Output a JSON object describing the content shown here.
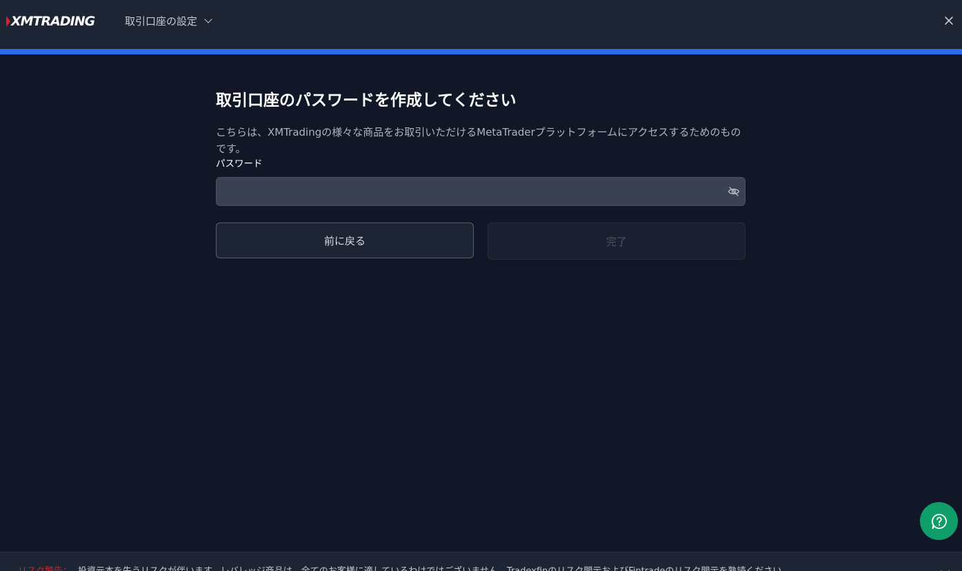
{
  "header": {
    "logo_text": "XMTRADING",
    "menu_title": "取引口座の設定"
  },
  "progress": {
    "fraction": 1.0,
    "color": "#2c6bed"
  },
  "main": {
    "heading": "取引口座のパスワードを作成してください",
    "description": "こちらは、XMTradingの様々な商品をお取引いただけるMetaTraderプラットフォームにアクセスするためのものです。",
    "password_label": "パスワード",
    "password_value": "",
    "back_button": "前に戻る",
    "done_button": "完了"
  },
  "risk": {
    "label": "リスク警告：",
    "text": "投資元本を失うリスクが伴います。レバレッジ商品は、全てのお客様に適しているわけではございません。Tradexfinのリスク開示およびFintradeのリスク開示を熟読ください。"
  },
  "icons": {
    "logo": "xm-logo-icon",
    "chevron": "chevron-down-icon",
    "close": "close-icon",
    "eye": "eye-off-icon",
    "help": "help-question-icon"
  },
  "colors": {
    "accent": "#2c6bed",
    "help_button": "#0f9d6a",
    "risk_label": "#c0282e",
    "background": "#111726"
  }
}
